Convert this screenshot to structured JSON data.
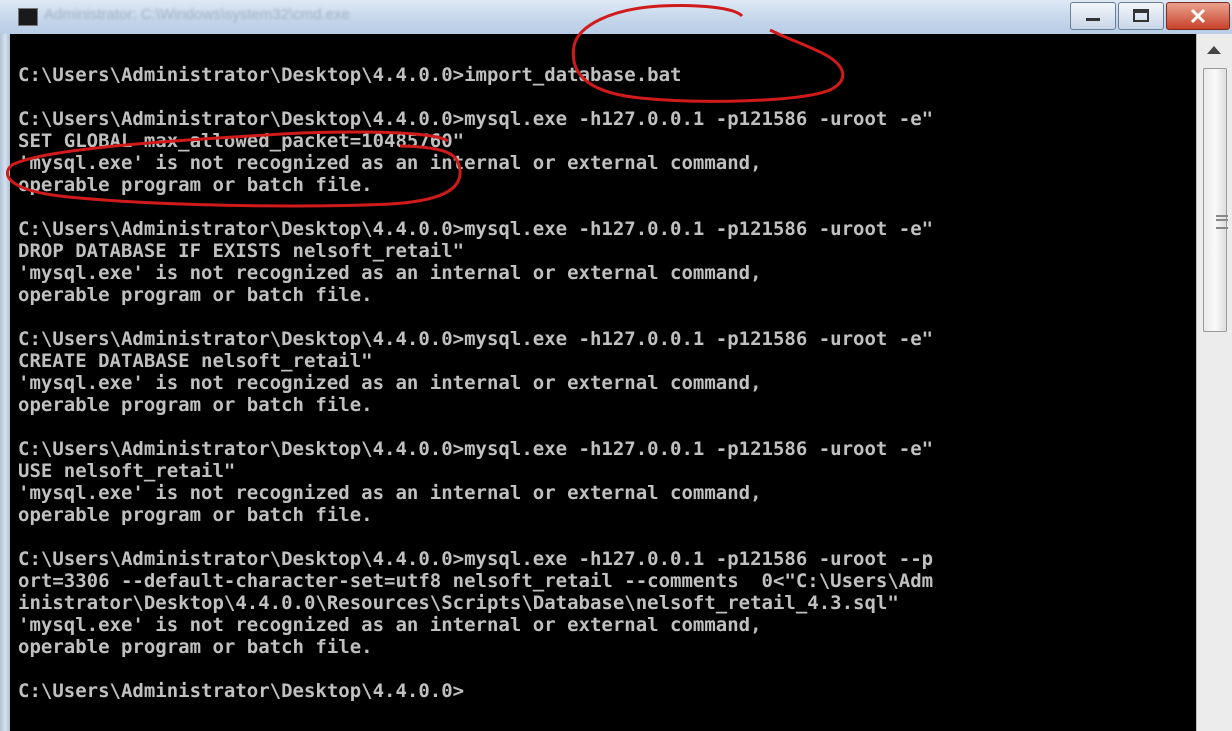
{
  "window": {
    "title": "Administrator: C:\\Windows\\system32\\cmd.exe",
    "controls": [
      "minimize",
      "maximize",
      "close"
    ],
    "accent_color": "#d11a1a"
  },
  "terminal": {
    "lines": [
      "C:\\Users\\Administrator\\Desktop\\4.4.0.0>import_database.bat",
      "",
      "C:\\Users\\Administrator\\Desktop\\4.4.0.0>mysql.exe -h127.0.0.1 -p121586 -uroot -e\"",
      "SET GLOBAL max_allowed_packet=10485760\"",
      "'mysql.exe' is not recognized as an internal or external command,",
      "operable program or batch file.",
      "",
      "C:\\Users\\Administrator\\Desktop\\4.4.0.0>mysql.exe -h127.0.0.1 -p121586 -uroot -e\"",
      "DROP DATABASE IF EXISTS nelsoft_retail\"",
      "'mysql.exe' is not recognized as an internal or external command,",
      "operable program or batch file.",
      "",
      "C:\\Users\\Administrator\\Desktop\\4.4.0.0>mysql.exe -h127.0.0.1 -p121586 -uroot -e\"",
      "CREATE DATABASE nelsoft_retail\"",
      "'mysql.exe' is not recognized as an internal or external command,",
      "operable program or batch file.",
      "",
      "C:\\Users\\Administrator\\Desktop\\4.4.0.0>mysql.exe -h127.0.0.1 -p121586 -uroot -e\"",
      "USE nelsoft_retail\"",
      "'mysql.exe' is not recognized as an internal or external command,",
      "operable program or batch file.",
      "",
      "C:\\Users\\Administrator\\Desktop\\4.4.0.0>mysql.exe -h127.0.0.1 -p121586 -uroot --p",
      "ort=3306 --default-character-set=utf8 nelsoft_retail --comments  0<\"C:\\Users\\Adm",
      "inistrator\\Desktop\\4.4.0.0\\Resources\\Scripts\\Database\\nelsoft_retail_4.3.sql\"",
      "'mysql.exe' is not recognized as an internal or external command,",
      "operable program or batch file.",
      "",
      "C:\\Users\\Administrator\\Desktop\\4.4.0.0>"
    ]
  }
}
